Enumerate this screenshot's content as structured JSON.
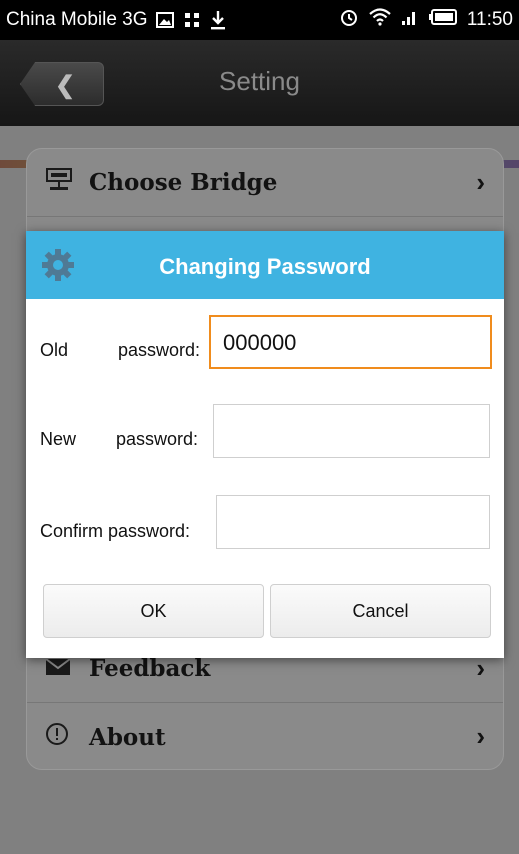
{
  "status_bar": {
    "carrier": "China Mobile 3G",
    "time": "11:50",
    "icons": [
      "image-notification-icon",
      "app-notification-icon",
      "download-icon",
      "alarm-icon",
      "wifi-icon",
      "signal-icon",
      "battery-icon"
    ]
  },
  "header": {
    "title": "Setting",
    "back_icon": "chevron-left-icon"
  },
  "settings_list": {
    "items": [
      {
        "label": "Choose Bridge",
        "icon": "bridge-icon"
      },
      {
        "label": "Feedback",
        "icon": "envelope-icon"
      },
      {
        "label": "About",
        "icon": "info-icon"
      }
    ]
  },
  "dialog": {
    "title": "Changing Password",
    "icon": "gear-icon",
    "header_color": "#3fb3e1",
    "focus_color": "#f08c1d",
    "fields": {
      "old": {
        "label_a": "Old",
        "label_b": "password:",
        "value": "000000"
      },
      "new": {
        "label_a": "New",
        "label_b": "password:",
        "value": ""
      },
      "confirm": {
        "label": "Confirm password:",
        "value": ""
      }
    },
    "ok_label": "OK",
    "cancel_label": "Cancel"
  }
}
